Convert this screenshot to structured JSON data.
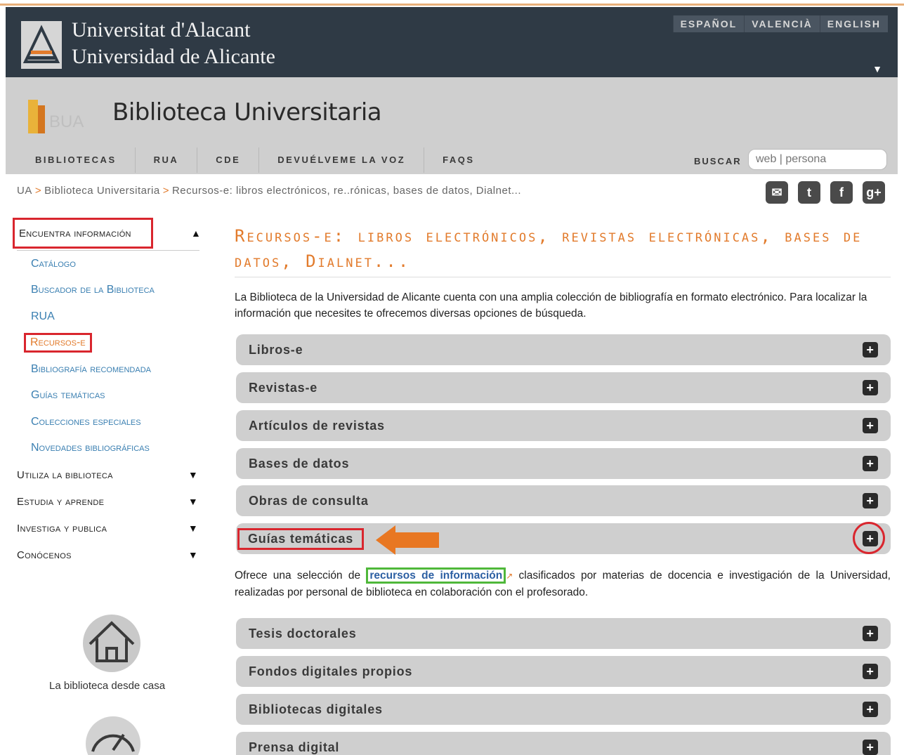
{
  "university": {
    "name_line1": "Universitat d'Alacant",
    "name_line2": "Universidad de Alicante",
    "languages": [
      "ESPAÑOL",
      "VALENCIÀ",
      "ENGLISH"
    ]
  },
  "library": {
    "logo_text": "BUA",
    "title": "Biblioteca Universitaria",
    "nav": [
      "BIBLIOTECAS",
      "RUA",
      "CDE",
      "DEVUÉLVEME LA VOZ",
      "FAQS"
    ],
    "search_label": "BUSCAR",
    "search_placeholder": "web | persona"
  },
  "breadcrumb": {
    "items": [
      "UA",
      "Biblioteca Universitaria",
      "Recursos-e: libros electrónicos, re..rónicas, bases de datos, Dialnet..."
    ]
  },
  "social": [
    "email-icon",
    "twitter-icon",
    "facebook-icon",
    "googleplus-icon"
  ],
  "sidebar": {
    "sections": [
      {
        "label": "Encuentra información",
        "expanded": true,
        "items": [
          "Catálogo",
          "Buscador de la Biblioteca",
          "RUA",
          "Recursos-e",
          "Bibliografía recomendada",
          "Guías temáticas",
          "Colecciones especiales",
          "Novedades bibliográficas"
        ]
      },
      {
        "label": "Utiliza la biblioteca",
        "expanded": false
      },
      {
        "label": "Estudia y aprende",
        "expanded": false
      },
      {
        "label": "Investiga y publica",
        "expanded": false
      },
      {
        "label": "Conócenos",
        "expanded": false
      }
    ],
    "home_label": "La biblioteca desde casa"
  },
  "main": {
    "title": "Recursos-e: libros electrónicos, revistas electrónicas, bases de datos, Dialnet...",
    "intro": "La Biblioteca de la Universidad de Alicante cuenta con una amplia colección de bibliografía en formato electrónico. Para localizar la información que necesites te ofrecemos diversas opciones de búsqueda.",
    "accordion": [
      "Libros-e",
      "Revistas-e",
      "Artículos de revistas",
      "Bases de datos",
      "Obras de consulta",
      "Guías temáticas",
      "Tesis doctorales",
      "Fondos digitales propios",
      "Bibliotecas digitales",
      "Prensa digital"
    ],
    "guides_desc_before": "Ofrece una selección de",
    "guides_desc_link": "recursos de información",
    "guides_desc_after": "clasificados por materias de docencia e investigación de la Universidad, realizadas por personal de biblioteca en colaboración con el profesorado."
  },
  "colors": {
    "accent_orange": "#e27b2c",
    "link_blue": "#3a7fb1",
    "highlight_red": "#d9262e",
    "highlight_green": "#4fb83a",
    "header_dark": "#2f3a45"
  }
}
